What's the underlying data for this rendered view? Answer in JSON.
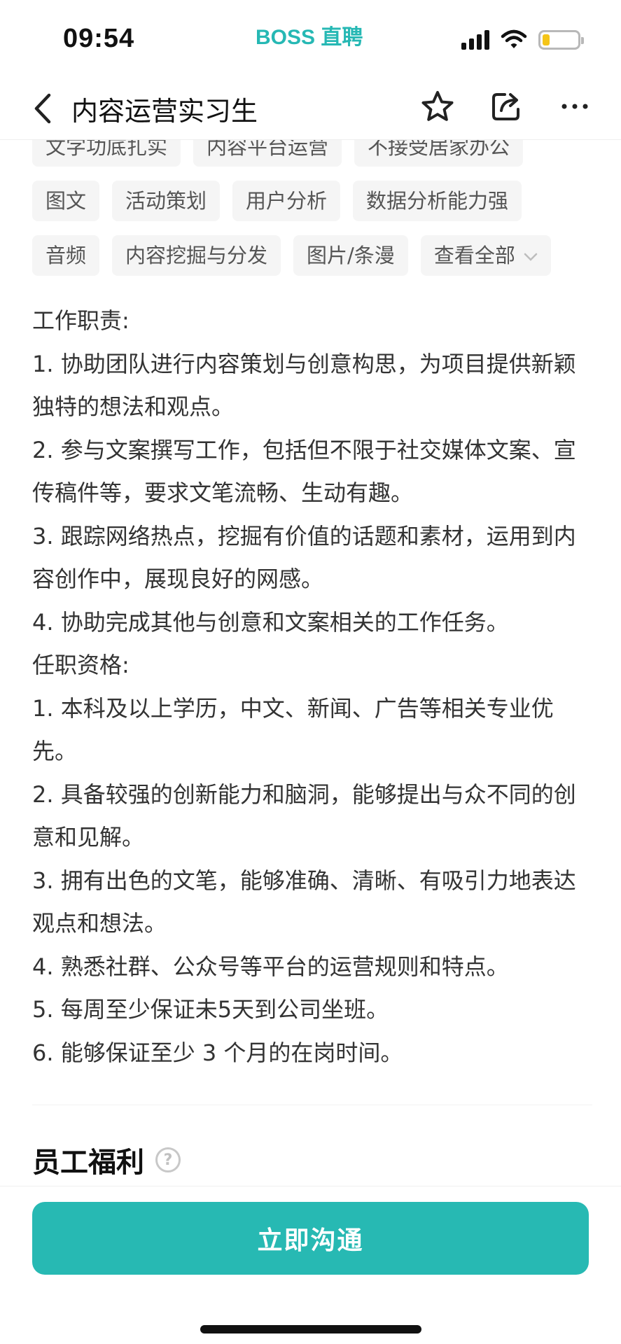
{
  "status_bar": {
    "time": "09:54",
    "brand": "BOSS 直聘",
    "icons": [
      "signal-icon",
      "wifi-icon",
      "battery-icon"
    ],
    "battery_color": "#f5c518"
  },
  "nav": {
    "title": "内容运营实习生",
    "icons": [
      "back-icon",
      "star-icon",
      "share-icon",
      "more-icon"
    ]
  },
  "tags": {
    "row1": [
      "文字功底扎实",
      "内容平台运营",
      "不接受居家办公"
    ],
    "row2": [
      "图文",
      "活动策划",
      "用户分析",
      "数据分析能力强"
    ],
    "row3": [
      "音频",
      "内容挖掘与分发",
      "图片/条漫"
    ],
    "view_all": "查看全部"
  },
  "description": {
    "duties_heading": "工作职责:",
    "duties": [
      "1. 协助团队进行内容策划与创意构思，为项目提供新颖独特的想法和观点。",
      "2. 参与文案撰写工作，包括但不限于社交媒体文案、宣传稿件等，要求文笔流畅、生动有趣。",
      "3. 跟踪网络热点，挖掘有价值的话题和素材，运用到内容创作中，展现良好的网感。",
      "4. 协助完成其他与创意和文案相关的工作任务。"
    ],
    "qualifications_heading": "任职资格:",
    "qualifications": [
      "1. 本科及以上学历，中文、新闻、广告等相关专业优先。",
      "2. 具备较强的创新能力和脑洞，能够提出与众不同的创意和见解。",
      "3. 拥有出色的文笔，能够准确、清晰、有吸引力地表达观点和想法。",
      "4. 熟悉社群、公众号等平台的运营规则和特点。",
      "5. 每周至少保证未5天到公司坐班。",
      "6. 能够保证至少 3 个月的在岗时间。"
    ]
  },
  "benefits": {
    "title": "员工福利",
    "help_glyph": "?"
  },
  "action": {
    "chat_label": "立即沟通",
    "color": "#27b9b3"
  }
}
